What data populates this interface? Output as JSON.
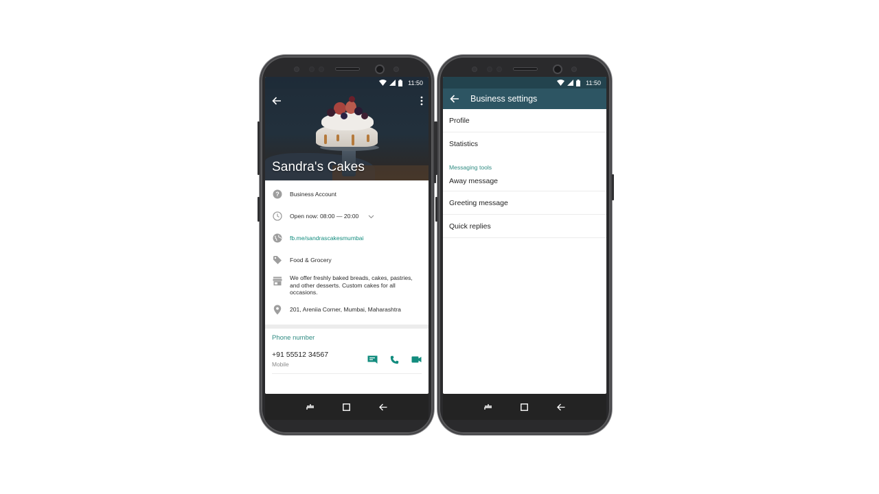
{
  "status_bar": {
    "time": "11:50",
    "icons": [
      "wifi-icon",
      "signal-icon",
      "battery-icon"
    ]
  },
  "left_phone": {
    "toolbar": {
      "back_icon": "arrow-left-icon",
      "menu_icon": "more-vert-icon"
    },
    "business_name": "Sandra's Cakes",
    "info": [
      {
        "icon": "help-circle-icon",
        "text": "Business Account"
      },
      {
        "icon": "clock-icon",
        "text": "Open now: 08:00 — 20:00",
        "expand_icon": "chevron-down-icon"
      },
      {
        "icon": "globe-icon",
        "text": "fb.me/sandrascakesmumbai",
        "is_link": true
      },
      {
        "icon": "tag-icon",
        "text": "Food & Grocery"
      },
      {
        "icon": "store-icon",
        "text": "We offer freshly baked breads, cakes, pastries, and other desserts. Custom cakes for all occasions."
      },
      {
        "icon": "location-pin-icon",
        "text": "201, Areniia Corner, Mumbai, Maharashtra"
      }
    ],
    "phone_section": {
      "header": "Phone number",
      "number": "+91 55512 34567",
      "type": "Mobile",
      "actions": [
        "message-icon",
        "phone-icon",
        "video-icon"
      ]
    }
  },
  "right_phone": {
    "header": {
      "back_icon": "arrow-left-icon",
      "title": "Business settings"
    },
    "items_top": [
      "Profile",
      "Statistics"
    ],
    "subheader": "Messaging tools",
    "items_tools": [
      "Away message",
      "Greeting message",
      "Quick replies"
    ]
  },
  "nav_bar": {
    "buttons": [
      "recents-icon",
      "home-icon",
      "back-icon"
    ]
  },
  "colors": {
    "accent": "#128c7e",
    "header": "#2d5563",
    "section_header": "#2f8b82"
  }
}
